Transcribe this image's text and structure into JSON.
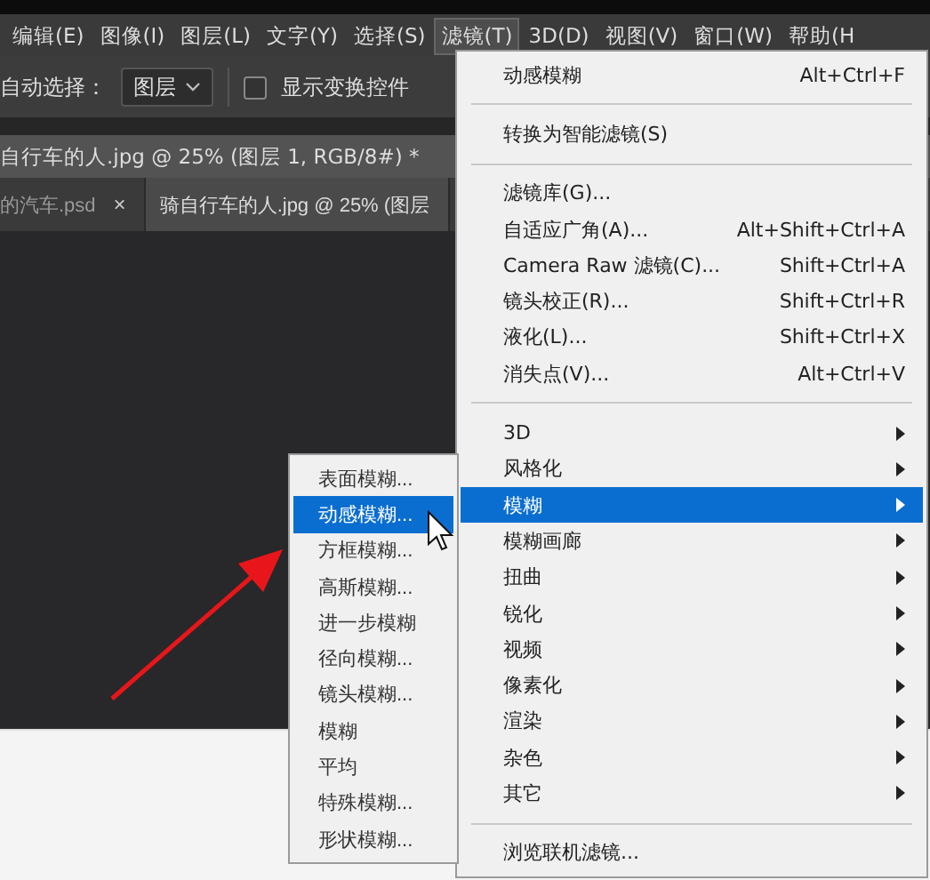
{
  "menubar": [
    {
      "label": "编辑(E)",
      "selected": false
    },
    {
      "label": "图像(I)",
      "selected": false
    },
    {
      "label": "图层(L)",
      "selected": false
    },
    {
      "label": "文字(Y)",
      "selected": false
    },
    {
      "label": "选择(S)",
      "selected": false
    },
    {
      "label": "滤镜(T)",
      "selected": true
    },
    {
      "label": "3D(D)",
      "selected": false
    },
    {
      "label": "视图(V)",
      "selected": false
    },
    {
      "label": "窗口(W)",
      "selected": false
    },
    {
      "label": "帮助(H",
      "selected": false
    }
  ],
  "options_bar": {
    "auto_select_label": "自动选择：",
    "layer_dropdown": "图层",
    "show_transform": {
      "label": "显示变换控件",
      "checked": false
    }
  },
  "document_title": "自行车的人.jpg @ 25% (图层 1, RGB/8#) *",
  "tabs": [
    {
      "label": "的汽车.psd",
      "close": "×",
      "selected": false
    },
    {
      "label": "骑自行车的人.jpg @ 25% (图层",
      "selected": true
    }
  ],
  "filter_menu": [
    {
      "kind": "item",
      "label": "动感模糊",
      "shortcut": "Alt+Ctrl+F",
      "selected": false
    },
    {
      "kind": "separator"
    },
    {
      "kind": "item",
      "label": "转换为智能滤镜(S)",
      "selected": false
    },
    {
      "kind": "separator"
    },
    {
      "kind": "item",
      "label": "滤镜库(G)...",
      "selected": false
    },
    {
      "kind": "item",
      "label": "自适应广角(A)...",
      "shortcut": "Alt+Shift+Ctrl+A",
      "selected": false
    },
    {
      "kind": "item",
      "label": "Camera Raw 滤镜(C)...",
      "shortcut": "Shift+Ctrl+A",
      "selected": false
    },
    {
      "kind": "item",
      "label": "镜头校正(R)...",
      "shortcut": "Shift+Ctrl+R",
      "selected": false
    },
    {
      "kind": "item",
      "label": "液化(L)...",
      "shortcut": "Shift+Ctrl+X",
      "selected": false
    },
    {
      "kind": "item",
      "label": "消失点(V)...",
      "shortcut": "Alt+Ctrl+V",
      "selected": false
    },
    {
      "kind": "separator"
    },
    {
      "kind": "submenu",
      "label": "3D",
      "selected": false
    },
    {
      "kind": "submenu",
      "label": "风格化",
      "selected": false
    },
    {
      "kind": "submenu",
      "label": "模糊",
      "selected": true
    },
    {
      "kind": "submenu",
      "label": "模糊画廊",
      "selected": false
    },
    {
      "kind": "submenu",
      "label": "扭曲",
      "selected": false
    },
    {
      "kind": "submenu",
      "label": "锐化",
      "selected": false
    },
    {
      "kind": "submenu",
      "label": "视频",
      "selected": false
    },
    {
      "kind": "submenu",
      "label": "像素化",
      "selected": false
    },
    {
      "kind": "submenu",
      "label": "渲染",
      "selected": false
    },
    {
      "kind": "submenu",
      "label": "杂色",
      "selected": false
    },
    {
      "kind": "submenu",
      "label": "其它",
      "selected": false
    },
    {
      "kind": "separator"
    },
    {
      "kind": "item",
      "label": "浏览联机滤镜...",
      "selected": false
    }
  ],
  "blur_submenu": [
    {
      "label": "表面模糊...",
      "selected": false
    },
    {
      "label": "动感模糊...",
      "selected": true
    },
    {
      "label": "方框模糊...",
      "selected": false
    },
    {
      "label": "高斯模糊...",
      "selected": false
    },
    {
      "label": "进一步模糊",
      "selected": false
    },
    {
      "label": "径向模糊...",
      "selected": false
    },
    {
      "label": "镜头模糊...",
      "selected": false
    },
    {
      "label": "模糊",
      "selected": false
    },
    {
      "label": "平均",
      "selected": false
    },
    {
      "label": "特殊模糊...",
      "selected": false
    },
    {
      "label": "形状模糊...",
      "selected": false
    }
  ]
}
